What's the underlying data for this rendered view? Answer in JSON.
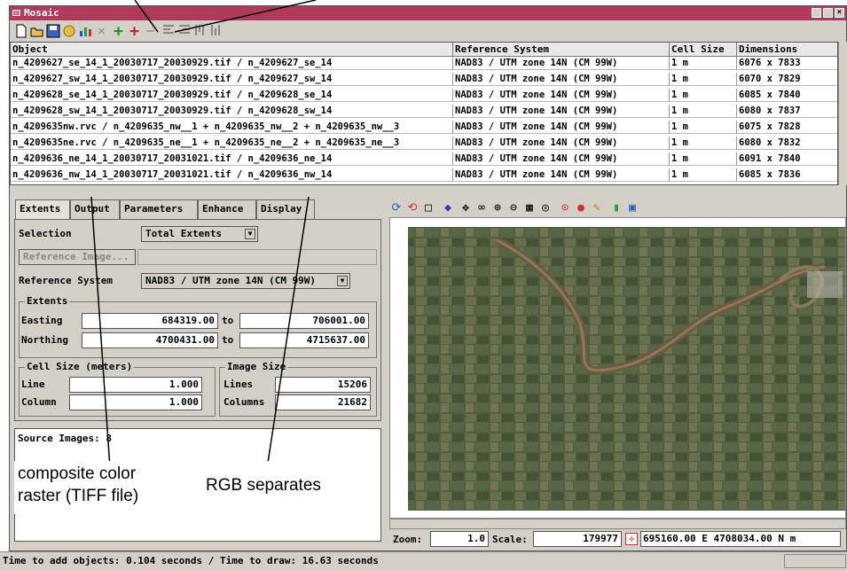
{
  "window": {
    "title": "Mosaic"
  },
  "toolbar": {
    "icons": [
      "new-icon",
      "open-icon",
      "save-icon",
      "wand-icon",
      "chart-icon",
      "delete-icon",
      "add-icon",
      "add-rgb-icon",
      "remove-icon",
      "align-left-icon",
      "align-right-icon",
      "align-up-icon",
      "align-down-icon"
    ],
    "symbols": {
      "add": "+",
      "remove": "—",
      "delete": "✕"
    }
  },
  "table": {
    "headers": {
      "object": "Object",
      "ref": "Reference System",
      "cell": "Cell Size",
      "dim": "Dimensions"
    },
    "rows": [
      {
        "object": "n_4209627_se_14_1_20030717_20030929.tif / n_4209627_se_14",
        "ref": "NAD83 / UTM zone 14N (CM 99W)",
        "cell": "1 m",
        "dim": "6076 x 7833"
      },
      {
        "object": "n_4209627_sw_14_1_20030717_20030929.tif / n_4209627_sw_14",
        "ref": "NAD83 / UTM zone 14N (CM 99W)",
        "cell": "1 m",
        "dim": "6070 x 7829"
      },
      {
        "object": "n_4209628_se_14_1_20030717_20030929.tif / n_4209628_se_14",
        "ref": "NAD83 / UTM zone 14N (CM 99W)",
        "cell": "1 m",
        "dim": "6085 x 7840"
      },
      {
        "object": "n_4209628_sw_14_1_20030717_20030929.tif / n_4209628_sw_14",
        "ref": "NAD83 / UTM zone 14N (CM 99W)",
        "cell": "1 m",
        "dim": "6080 x 7837"
      },
      {
        "object": "n_4209635nw.rvc / n_4209635_nw__1 + n_4209635_nw__2 + n_4209635_nw__3",
        "ref": "NAD83 / UTM zone 14N (CM 99W)",
        "cell": "1 m",
        "dim": "6075 x 7828"
      },
      {
        "object": "n_4209635ne.rvc / n_4209635_ne__1 + n_4209635_ne__2 + n_4209635_ne__3",
        "ref": "NAD83 / UTM zone 14N (CM 99W)",
        "cell": "1 m",
        "dim": "6080 x 7832"
      },
      {
        "object": "n_4209636_ne_14_1_20030717_20031021.tif / n_4209636_ne_14",
        "ref": "NAD83 / UTM zone 14N (CM 99W)",
        "cell": "1 m",
        "dim": "6091 x 7840"
      },
      {
        "object": "n_4209636_nw_14_1_20030717_20031021.tif / n_4209636_nw_14",
        "ref": "NAD83 / UTM zone 14N (CM 99W)",
        "cell": "1 m",
        "dim": "6085 x 7836"
      }
    ]
  },
  "tabs": [
    "Extents",
    "Output",
    "Parameters",
    "Enhance",
    "Display"
  ],
  "extents": {
    "selection_label": "Selection",
    "selection_value": "Total Extents",
    "reference_image_button": "Reference Image...",
    "reference_system_label": "Reference System",
    "reference_system_value": "NAD83 / UTM zone 14N (CM 99W)",
    "extents_group": "Extents",
    "easting_label": "Easting",
    "easting_from": "684319.00",
    "easting_to": "706001.00",
    "northing_label": "Northing",
    "northing_from": "4700431.00",
    "northing_to": "4715637.00",
    "to_label": "to",
    "cellsize_group": "Cell Size (meters)",
    "line_label": "Line",
    "line_value": "1.000",
    "column_label": "Column",
    "column_value": "1.000",
    "imagesize_group": "Image Size",
    "lines_label": "Lines",
    "lines_value": "15206",
    "columns_label": "Columns",
    "columns_value": "21682"
  },
  "source": {
    "label": "Source Images: 8"
  },
  "view": {
    "zoom_label": "Zoom:",
    "zoom_value": "1.0",
    "scale_label": "Scale:",
    "scale_value": "179977",
    "coords": "695160.00 E  4708034.00 N m"
  },
  "status": {
    "text": "Time to add objects: 0.104 seconds  /  Time to draw: 16.63 seconds"
  },
  "annotations": {
    "left_line1": "composite color",
    "left_line2": "raster (TIFF file)",
    "right": "RGB separates"
  },
  "colors": {
    "titlebar": "#b03a5b",
    "panel": "#d4d0c8",
    "add_green": "#1a9a1a",
    "add_red": "#cc2222"
  }
}
